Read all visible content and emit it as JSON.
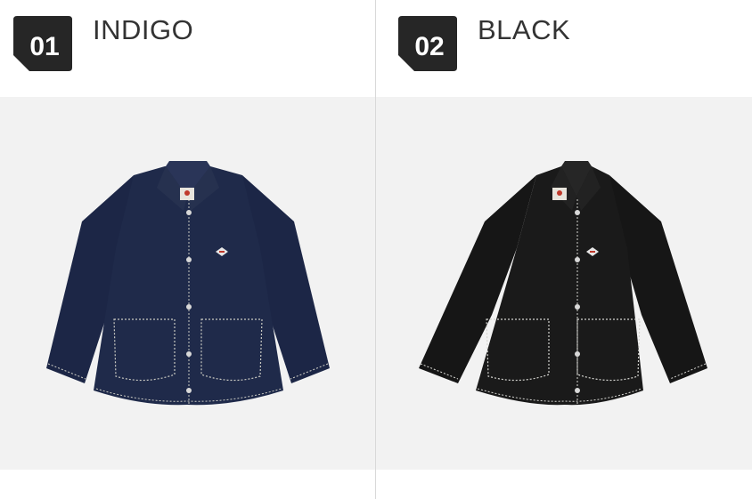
{
  "products": [
    {
      "number": "01",
      "color_name": "INDIGO",
      "jacket_color": "#1f2a4a",
      "stitch_color": "#c9c9c2",
      "image": "indigo-denim-coverall-jacket"
    },
    {
      "number": "02",
      "color_name": "BLACK",
      "jacket_color": "#1a1a1a",
      "stitch_color": "#d4d4d0",
      "image": "black-denim-coverall-jacket"
    }
  ],
  "badge_color": "#262626",
  "background_color": "#f2f2f2"
}
